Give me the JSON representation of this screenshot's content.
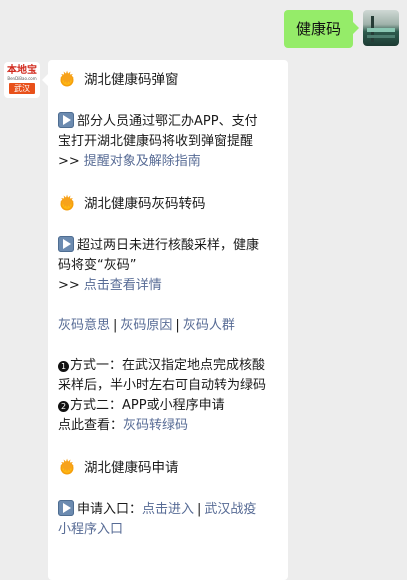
{
  "outgoing": {
    "text": "健康码"
  },
  "incoming_avatar": {
    "brand": "本地宝",
    "domain": "BenDiBao.com",
    "city": "武汉"
  },
  "card": {
    "sec1": {
      "title": "湖北健康码弹窗",
      "body_l1": "部分人员通过鄂汇办APP、支付",
      "body_l2": "宝打开湖北健康码将收到弹窗提醒",
      "arrow": ">>",
      "link": "提醒对象及解除指南"
    },
    "sec2": {
      "title": "湖北健康码灰码转码",
      "body_l1": "超过两日未进行核酸采样，健康",
      "body_l2": "码将变“灰码”",
      "arrow": ">>",
      "link": "点击查看详情"
    },
    "gray_links": [
      "灰码意思",
      "灰码原因",
      "灰码人群"
    ],
    "sep": "|",
    "method1_num": "1",
    "method1_l1": "方式一：在武汉指定地点完成核酸",
    "method1_l2": "采样后，半小时左右可自动转为绿码",
    "method2_num": "2",
    "method2_l1": "方式二：APP或小程序申请",
    "check_prefix": "点此查看：",
    "check_link": "灰码转绿码",
    "sec3": {
      "title": "湖北健康码申请",
      "body_prefix": "申请入口：",
      "link1": "点击进入",
      "link2": "武汉战疫",
      "link2_l2": "小程序入口"
    }
  }
}
